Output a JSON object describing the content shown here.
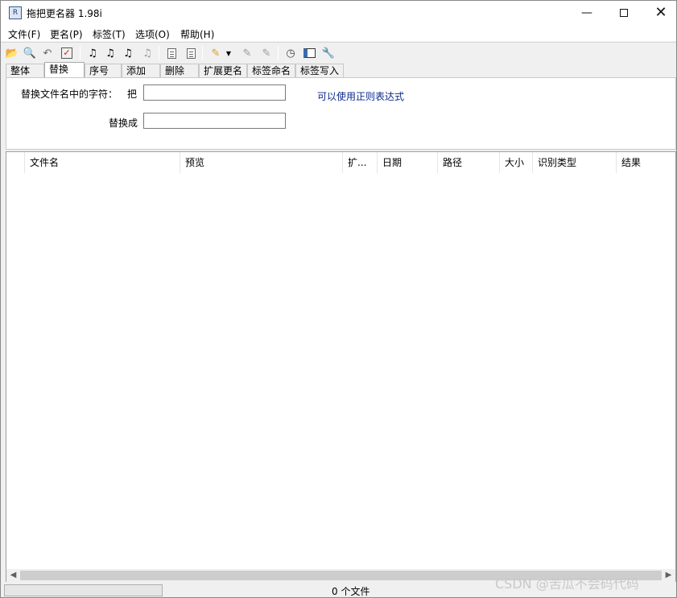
{
  "window": {
    "title": "拖把更名器 1.98i",
    "app_icon_glyph": "R",
    "close_glyph": "✕",
    "min_glyph": "—"
  },
  "menu": [
    "文件(F)",
    "更名(P)",
    "标签(T)",
    "选项(O)",
    "帮助(H)"
  ],
  "toolbar": {
    "icons": [
      "open-folder-icon",
      "search-icon",
      "undo-icon",
      "check-icon",
      "music-tag-icon",
      "music-tag-icon",
      "music-tag-icon",
      "music-tag-icon",
      "document-icon",
      "document-icon",
      "pen-icon",
      "dropdown-arrow-icon",
      "pen-erase-icon",
      "pen-delete-icon",
      "clock-icon",
      "window-icon",
      "wrench-icon"
    ]
  },
  "tabs": [
    "整体",
    "替换",
    "序号",
    "添加",
    "删除",
    "扩展更名",
    "标签命名",
    "标签写入"
  ],
  "active_tab": "替换",
  "replace_panel": {
    "find_label": "替换文件名中的字符：",
    "find_prefix": "把",
    "find_value": "",
    "replace_label": "替换成",
    "replace_value": "",
    "regex_hint": "可以使用正则表达式"
  },
  "columns": [
    "文件名",
    "预览",
    "扩...",
    "日期",
    "路径",
    "大小",
    "识别类型",
    "结果"
  ],
  "statusbar": {
    "progress": 0,
    "status": "0 个文件"
  },
  "watermark": "CSDN @苦瓜不会码代码"
}
